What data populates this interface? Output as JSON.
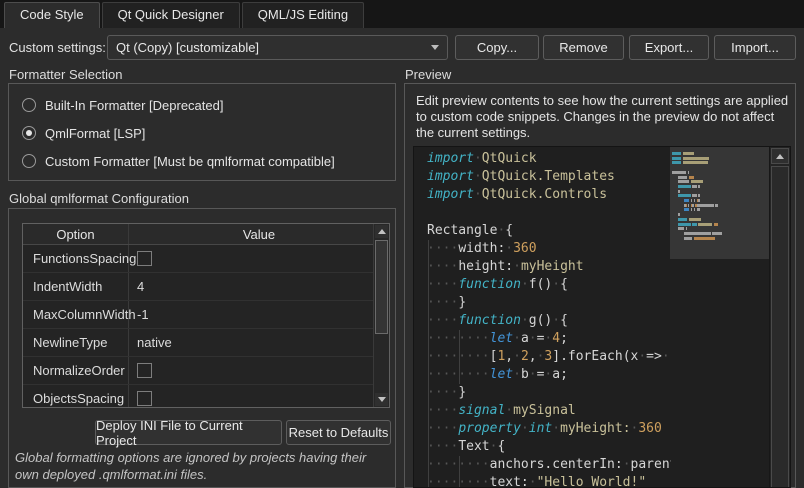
{
  "tabs": [
    {
      "label": "Code Style",
      "active": true
    },
    {
      "label": "Qt Quick Designer",
      "active": false
    },
    {
      "label": "QML/JS Editing",
      "active": false
    }
  ],
  "settings_row": {
    "label": "Custom settings:",
    "combo_value": "Qt (Copy) [customizable]",
    "buttons": [
      {
        "name": "copy",
        "label": "Copy..."
      },
      {
        "name": "remove",
        "label": "Remove"
      },
      {
        "name": "export",
        "label": "Export..."
      },
      {
        "name": "import",
        "label": "Import..."
      }
    ]
  },
  "formatter": {
    "title": "Formatter Selection",
    "options": [
      {
        "label": "Built-In Formatter [Deprecated]",
        "selected": false
      },
      {
        "label": "QmlFormat [LSP]",
        "selected": true
      },
      {
        "label": "Custom Formatter [Must be qmlformat compatible]",
        "selected": false
      }
    ]
  },
  "config": {
    "title": "Global qmlformat Configuration",
    "table": {
      "headers": [
        "Option",
        "Value"
      ],
      "rows": [
        {
          "option": "FunctionsSpacing",
          "type": "checkbox",
          "checked": false
        },
        {
          "option": "IndentWidth",
          "type": "text",
          "value": "4"
        },
        {
          "option": "MaxColumnWidth",
          "type": "text",
          "value": "-1"
        },
        {
          "option": "NewlineType",
          "type": "text",
          "value": "native"
        },
        {
          "option": "NormalizeOrder",
          "type": "checkbox",
          "checked": false
        },
        {
          "option": "ObjectsSpacing",
          "type": "checkbox",
          "checked": false
        }
      ]
    },
    "buttons": {
      "deploy": "Deploy INI File to Current Project",
      "reset": "Reset to Defaults"
    },
    "note": "Global formatting options are ignored by projects having their own deployed .qmlformat.ini files."
  },
  "preview": {
    "title": "Preview",
    "description": "Edit preview contents to see how the current settings are applied to custom code snippets. Changes in the preview do not affect the current settings.",
    "code": {
      "lines": [
        {
          "g": [],
          "t": [
            [
              "kw",
              "import"
            ],
            [
              "ws",
              "·"
            ],
            [
              "id",
              "QtQuick"
            ]
          ]
        },
        {
          "g": [],
          "t": [
            [
              "kw",
              "import"
            ],
            [
              "ws",
              "·"
            ],
            [
              "id",
              "QtQuick.Templates"
            ]
          ]
        },
        {
          "g": [],
          "t": [
            [
              "kw",
              "import"
            ],
            [
              "ws",
              "·"
            ],
            [
              "id",
              "QtQuick.Controls"
            ]
          ]
        },
        {
          "g": [],
          "t": []
        },
        {
          "g": [],
          "t": [
            [
              "plain",
              "Rectangle"
            ],
            [
              "ws",
              "·"
            ],
            [
              "plain",
              "{"
            ]
          ]
        },
        {
          "g": [
            0
          ],
          "t": [
            [
              "ws",
              "····"
            ],
            [
              "plain",
              "width:"
            ],
            [
              "ws",
              "·"
            ],
            [
              "num",
              "360"
            ]
          ]
        },
        {
          "g": [
            0
          ],
          "t": [
            [
              "ws",
              "····"
            ],
            [
              "plain",
              "height:"
            ],
            [
              "ws",
              "·"
            ],
            [
              "id",
              "myHeight"
            ]
          ]
        },
        {
          "g": [
            0
          ],
          "t": [
            [
              "ws",
              "····"
            ],
            [
              "kw",
              "function"
            ],
            [
              "ws",
              "·"
            ],
            [
              "plain",
              "f()"
            ],
            [
              "ws",
              "·"
            ],
            [
              "plain",
              "{"
            ]
          ]
        },
        {
          "g": [
            0
          ],
          "t": [
            [
              "ws",
              "····"
            ],
            [
              "plain",
              "}"
            ]
          ]
        },
        {
          "g": [
            0
          ],
          "t": [
            [
              "ws",
              "····"
            ],
            [
              "kw",
              "function"
            ],
            [
              "ws",
              "·"
            ],
            [
              "plain",
              "g()"
            ],
            [
              "ws",
              "·"
            ],
            [
              "plain",
              "{"
            ]
          ]
        },
        {
          "g": [
            0,
            4
          ],
          "t": [
            [
              "ws",
              "········"
            ],
            [
              "kwjs",
              "let"
            ],
            [
              "ws",
              "·"
            ],
            [
              "plain",
              "a"
            ],
            [
              "ws",
              "·"
            ],
            [
              "plain",
              "="
            ],
            [
              "ws",
              "·"
            ],
            [
              "num",
              "4"
            ],
            [
              "plain",
              ";"
            ]
          ]
        },
        {
          "g": [
            0,
            4
          ],
          "t": [
            [
              "ws",
              "········"
            ],
            [
              "plain",
              "["
            ],
            [
              "num",
              "1"
            ],
            [
              "plain",
              ","
            ],
            [
              "ws",
              "·"
            ],
            [
              "num",
              "2"
            ],
            [
              "plain",
              ","
            ],
            [
              "ws",
              "·"
            ],
            [
              "num",
              "3"
            ],
            [
              "plain",
              "].forEach(x"
            ],
            [
              "ws",
              "·"
            ],
            [
              "plain",
              "=>"
            ],
            [
              "ws",
              "·"
            ]
          ]
        },
        {
          "g": [
            0,
            4
          ],
          "t": [
            [
              "ws",
              "········"
            ],
            [
              "kwjs",
              "let"
            ],
            [
              "ws",
              "·"
            ],
            [
              "plain",
              "b"
            ],
            [
              "ws",
              "·"
            ],
            [
              "plain",
              "="
            ],
            [
              "ws",
              "·"
            ],
            [
              "plain",
              "a;"
            ]
          ]
        },
        {
          "g": [
            0
          ],
          "t": [
            [
              "ws",
              "····"
            ],
            [
              "plain",
              "}"
            ]
          ]
        },
        {
          "g": [
            0
          ],
          "t": [
            [
              "ws",
              "····"
            ],
            [
              "kw",
              "signal"
            ],
            [
              "ws",
              "·"
            ],
            [
              "id",
              "mySignal"
            ]
          ]
        },
        {
          "g": [
            0
          ],
          "t": [
            [
              "ws",
              "····"
            ],
            [
              "kw",
              "property"
            ],
            [
              "ws",
              "·"
            ],
            [
              "kw",
              "int"
            ],
            [
              "ws",
              "·"
            ],
            [
              "id",
              "myHeight:"
            ],
            [
              "ws",
              "·"
            ],
            [
              "num",
              "360"
            ]
          ]
        },
        {
          "g": [
            0
          ],
          "t": [
            [
              "ws",
              "····"
            ],
            [
              "plain",
              "Text"
            ],
            [
              "ws",
              "·"
            ],
            [
              "plain",
              "{"
            ]
          ]
        },
        {
          "g": [
            0,
            4
          ],
          "t": [
            [
              "ws",
              "········"
            ],
            [
              "plain",
              "anchors.centerIn:"
            ],
            [
              "ws",
              "·"
            ],
            [
              "plain",
              "parent"
            ]
          ]
        },
        {
          "g": [
            0,
            4
          ],
          "t": [
            [
              "ws",
              "········"
            ],
            [
              "plain",
              "text:"
            ],
            [
              "ws",
              "·"
            ],
            [
              "str",
              "\"Hello World!\""
            ]
          ]
        }
      ]
    }
  },
  "colors": {
    "kw": "#43b3c6",
    "kwjs": "#4394d8",
    "id": "#c9c19a",
    "num": "#cfa05e",
    "plain": "#d6d6d6",
    "str": "#c9c19a",
    "editor_bg": "#1f1f1f",
    "page_bg": "#2c2c2c"
  }
}
